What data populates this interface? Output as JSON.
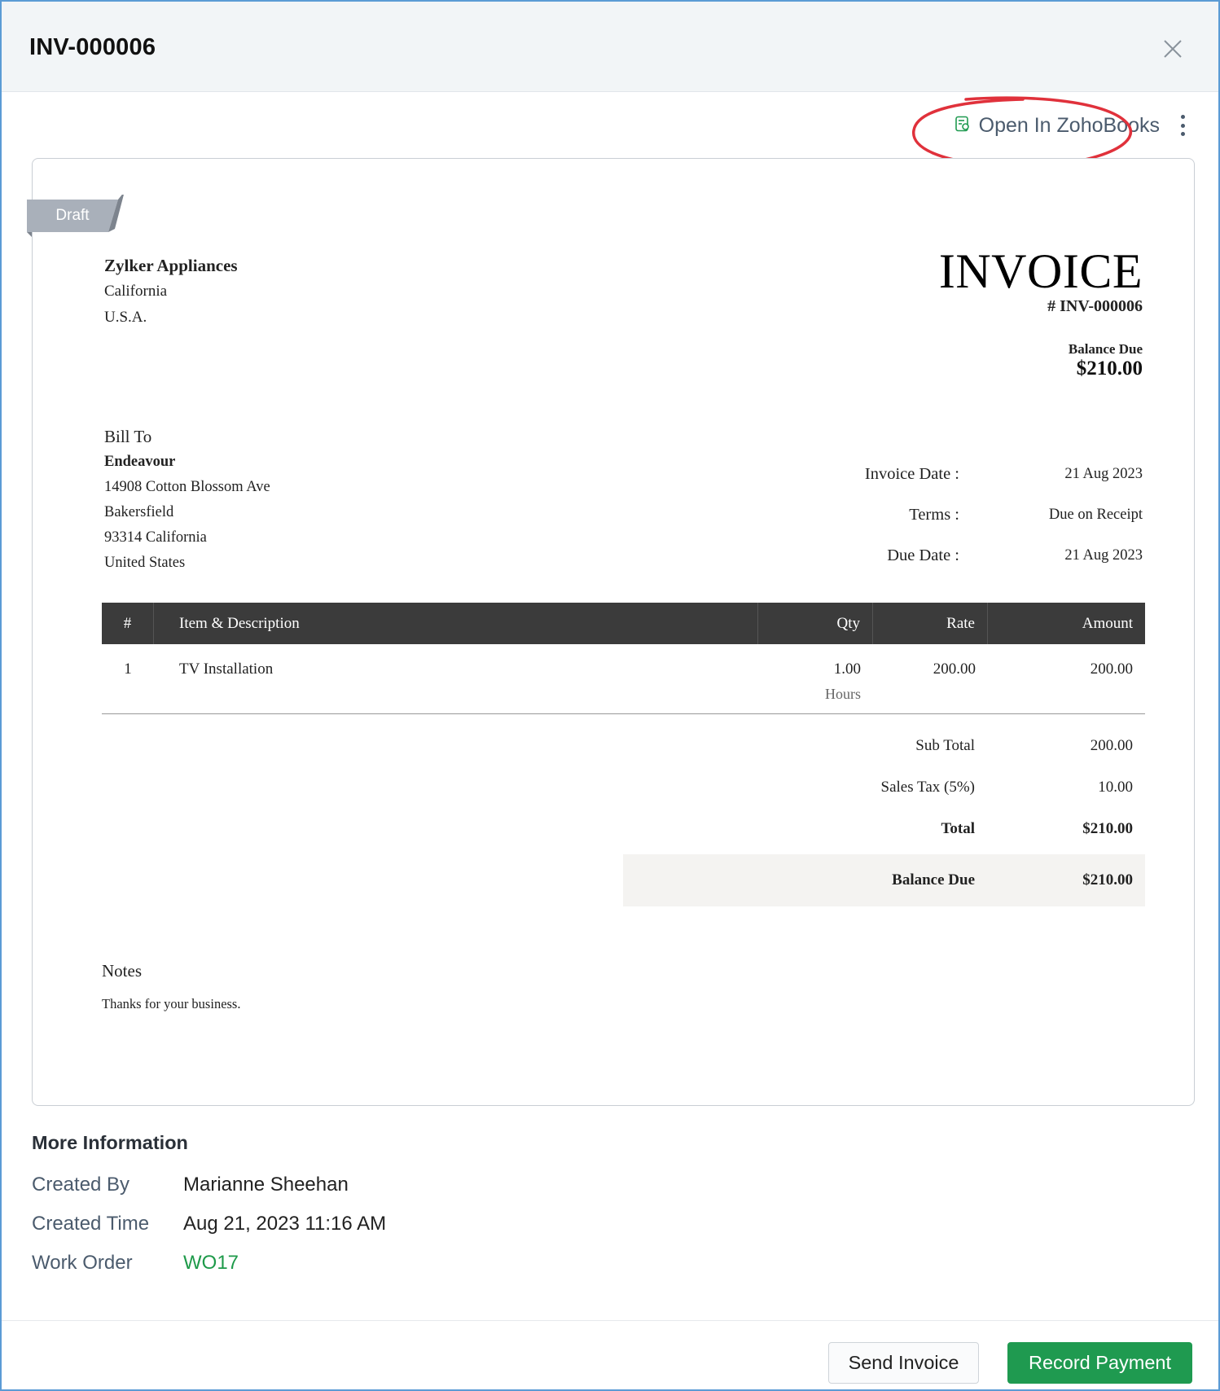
{
  "dialog": {
    "title": "INV-000006",
    "open_in_label": "Open In ZohoBooks"
  },
  "invoice": {
    "status_ribbon": "Draft",
    "organization": {
      "name": "Zylker Appliances",
      "line1": "California",
      "line2": "U.S.A."
    },
    "heading": "INVOICE",
    "number": "# INV-000006",
    "balance_due_label": "Balance Due",
    "balance_due_value": "$210.00",
    "bill_to": {
      "label": "Bill To",
      "name": "Endeavour",
      "address": [
        "14908 Cotton Blossom Ave",
        "Bakersfield",
        "93314 California",
        "United States"
      ]
    },
    "details": [
      {
        "label": "Invoice Date :",
        "value": "21 Aug 2023"
      },
      {
        "label": "Terms :",
        "value": "Due on Receipt"
      },
      {
        "label": "Due Date :",
        "value": "21 Aug 2023"
      }
    ],
    "table": {
      "headers": [
        "#",
        "Item & Description",
        "Qty",
        "Rate",
        "Amount"
      ],
      "rows": [
        {
          "num": "1",
          "item": "TV Installation",
          "qty": "1.00",
          "unit": "Hours",
          "rate": "200.00",
          "amount": "200.00"
        }
      ]
    },
    "totals": [
      {
        "label": "Sub Total",
        "value": "200.00"
      },
      {
        "label": "Sales Tax (5%)",
        "value": "10.00"
      },
      {
        "label": "Total",
        "value": "$210.00"
      },
      {
        "label": "Balance Due",
        "value": "$210.00"
      }
    ],
    "notes_label": "Notes",
    "notes_text": "Thanks for your business."
  },
  "more_info": {
    "heading": "More Information",
    "rows": [
      {
        "label": "Created By",
        "value": "Marianne Sheehan"
      },
      {
        "label": "Created Time",
        "value": "Aug 21, 2023 11:16 AM"
      },
      {
        "label": "Work Order",
        "value": "WO17"
      }
    ]
  },
  "footer": {
    "send_label": "Send Invoice",
    "record_label": "Record Payment"
  },
  "colors": {
    "accent_green": "#1f9a50",
    "highlight_ring": "#e0313b",
    "table_header": "#3b3b3b",
    "ribbon": "#a9b0ba"
  }
}
